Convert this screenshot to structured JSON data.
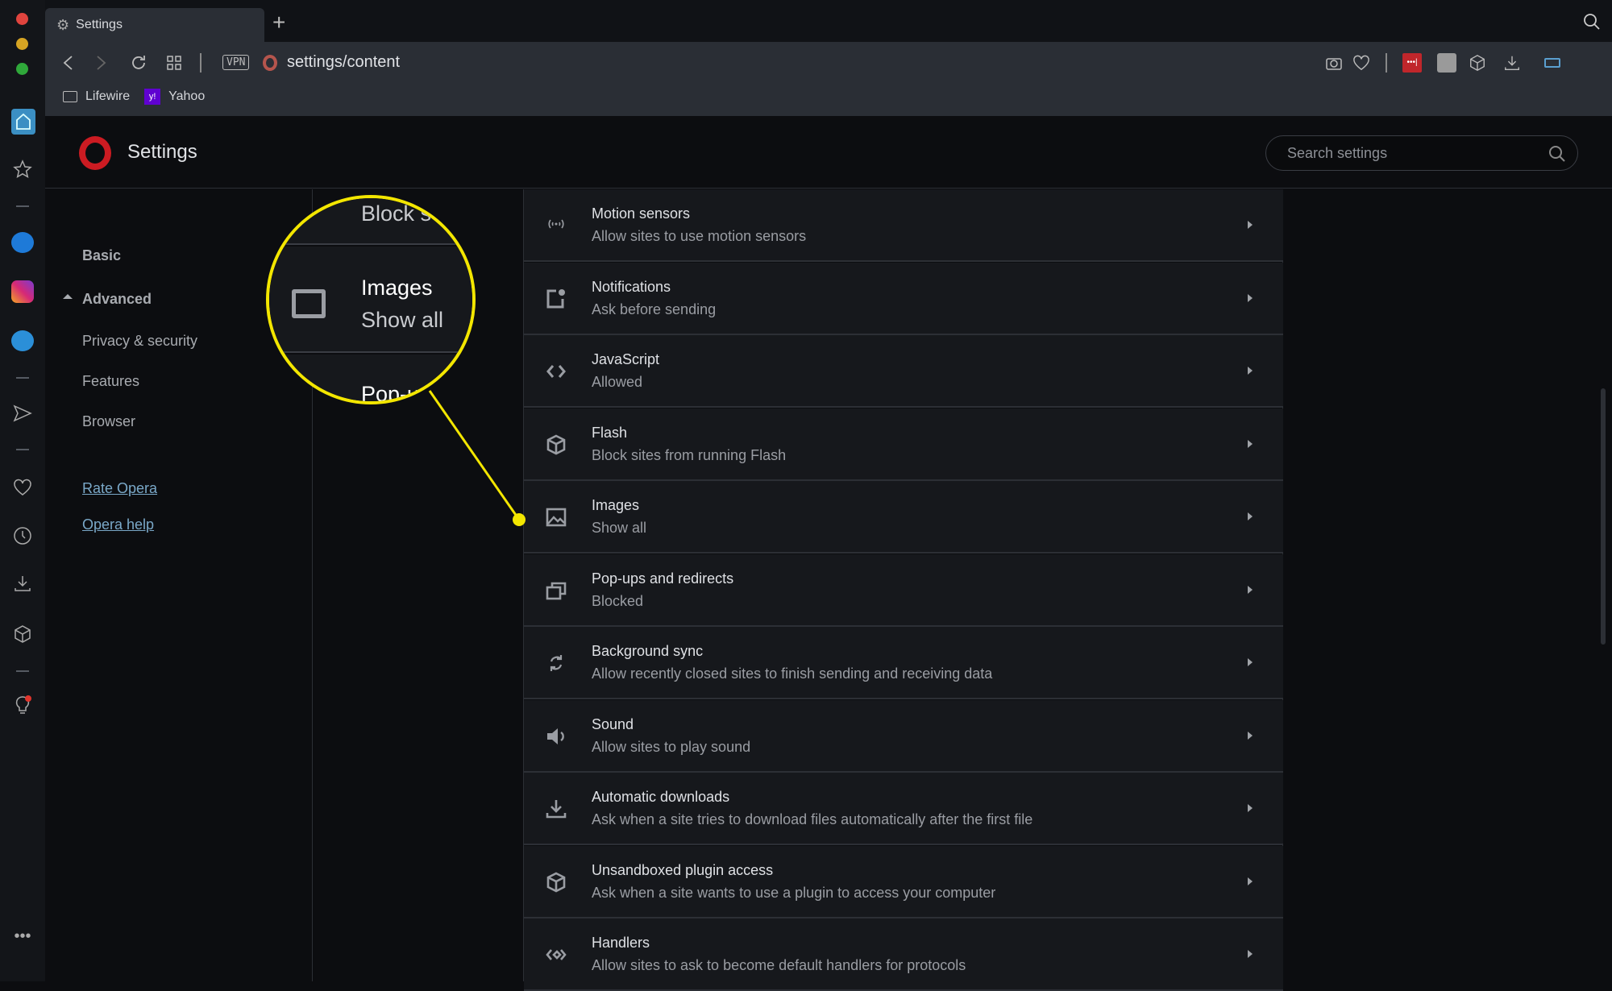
{
  "window": {
    "tab_title": "Settings",
    "new_tab": "+",
    "url": "settings/content",
    "vpn_label": "VPN"
  },
  "bookmarks": [
    {
      "label": "Lifewire",
      "icon": "folder-icon"
    },
    {
      "label": "Yahoo",
      "icon": "yahoo-icon"
    }
  ],
  "header": {
    "title": "Settings",
    "search_placeholder": "Search settings"
  },
  "nav": {
    "basic": "Basic",
    "advanced": "Advanced",
    "items": [
      "Privacy & security",
      "Features",
      "Browser"
    ],
    "links": [
      "Rate Opera",
      "Opera help"
    ]
  },
  "rows": [
    {
      "title": "Motion sensors",
      "subtitle": "Allow sites to use motion sensors",
      "icon": "motion-sensor-icon"
    },
    {
      "title": "Notifications",
      "subtitle": "Ask before sending",
      "icon": "notification-icon"
    },
    {
      "title": "JavaScript",
      "subtitle": "Allowed",
      "icon": "code-icon"
    },
    {
      "title": "Flash",
      "subtitle": "Block sites from running Flash",
      "icon": "cube-icon"
    },
    {
      "title": "Images",
      "subtitle": "Show all",
      "icon": "image-icon"
    },
    {
      "title": "Pop-ups and redirects",
      "subtitle": "Blocked",
      "icon": "popup-icon"
    },
    {
      "title": "Background sync",
      "subtitle": "Allow recently closed sites to finish sending and receiving data",
      "icon": "sync-icon"
    },
    {
      "title": "Sound",
      "subtitle": "Allow sites to play sound",
      "icon": "speaker-icon"
    },
    {
      "title": "Automatic downloads",
      "subtitle": "Ask when a site tries to download files automatically after the first file",
      "icon": "download-icon"
    },
    {
      "title": "Unsandboxed plugin access",
      "subtitle": "Ask when a site wants to use a plugin to access your computer",
      "icon": "cube-icon"
    },
    {
      "title": "Handlers",
      "subtitle": "Allow sites to ask to become default handlers for protocols",
      "icon": "handlers-icon"
    }
  ],
  "magnifier": {
    "above": "Block s",
    "title": "Images",
    "subtitle": "Show all",
    "below": "Pop-u"
  },
  "colors": {
    "highlight": "#f3e600",
    "opera_red": "#cc1b22",
    "link": "#7aa8c8"
  }
}
